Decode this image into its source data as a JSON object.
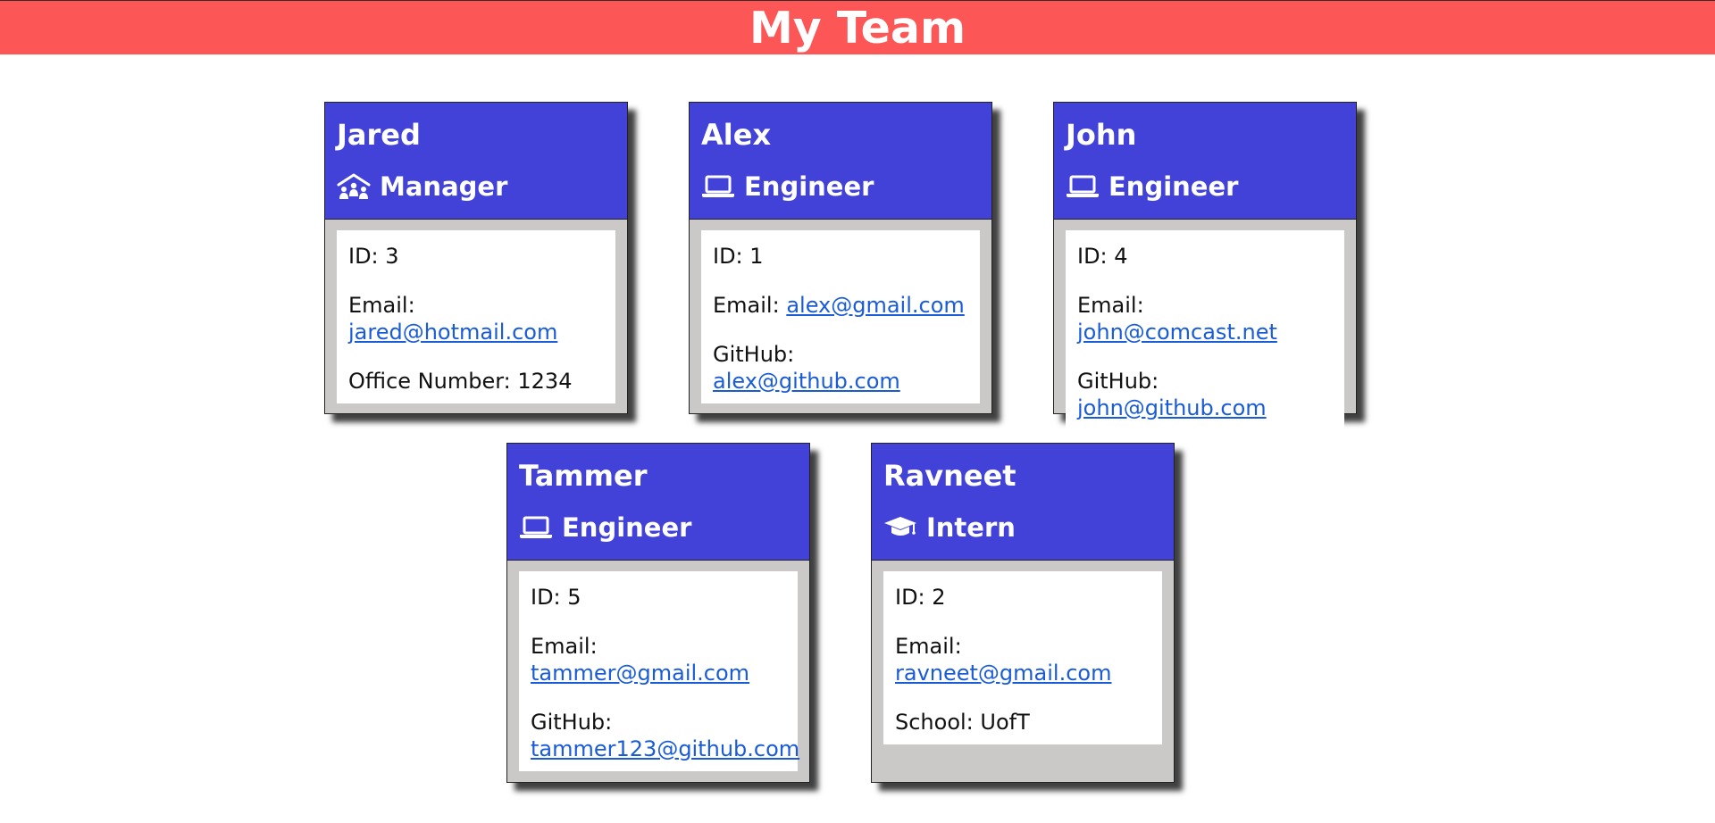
{
  "header": {
    "title": "My Team"
  },
  "cards": [
    {
      "name": "Jared",
      "role": "Manager",
      "icon": "people-roof-icon",
      "id_text": "ID: 3",
      "email_label": "Email:",
      "email": "jared@hotmail.com",
      "extra_label": "Office Number: 1234",
      "extra_value": ""
    },
    {
      "name": "Alex",
      "role": "Engineer",
      "icon": "laptop-icon",
      "id_text": "ID: 1",
      "email_label": "Email:",
      "email": "alex@gmail.com",
      "extra_label": "GitHub:",
      "extra_value": "alex@github.com"
    },
    {
      "name": "John",
      "role": "Engineer",
      "icon": "laptop-icon",
      "id_text": "ID: 4",
      "email_label": "Email:",
      "email": "john@comcast.net",
      "extra_label": "GitHub:",
      "extra_value": "john@github.com"
    },
    {
      "name": "Tammer",
      "role": "Engineer",
      "icon": "laptop-icon",
      "id_text": "ID: 5",
      "email_label": "Email:",
      "email": "tammer@gmail.com",
      "extra_label": "GitHub:",
      "extra_value": "tammer123@github.com"
    },
    {
      "name": "Ravneet",
      "role": "Intern",
      "icon": "graduation-cap-icon",
      "id_text": "ID: 2",
      "email_label": "Email:",
      "email": "ravneet@gmail.com",
      "extra_label": "School: UofT",
      "extra_value": ""
    }
  ],
  "colors": {
    "header_bg": "#fc5656",
    "card_head_bg": "#4242d8",
    "card_bg": "#cbc8c8",
    "link": "#1a5cd8"
  }
}
